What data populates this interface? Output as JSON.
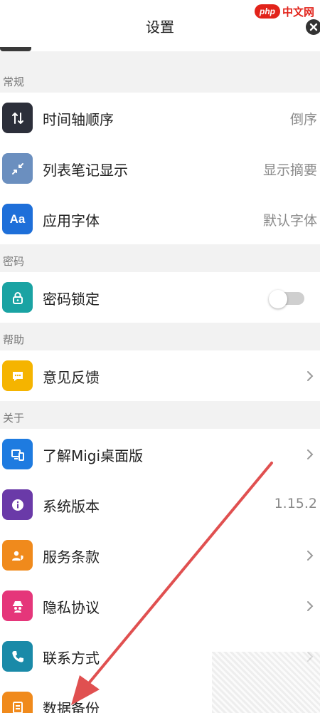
{
  "header": {
    "title": "设置"
  },
  "watermark": {
    "logo": "php",
    "text": "中文网"
  },
  "sections": {
    "general": {
      "label": "常规"
    },
    "password": {
      "label": "密码"
    },
    "help": {
      "label": "帮助"
    },
    "about": {
      "label": "关于"
    }
  },
  "general": [
    {
      "label": "时间轴顺序",
      "value": "倒序",
      "icon": "sort-arrows-icon",
      "color": "#2c2f3a"
    },
    {
      "label": "列表笔记显示",
      "value": "显示摘要",
      "icon": "collapse-icon",
      "color": "#6b8fbf"
    },
    {
      "label": "应用字体",
      "value": "默认字体",
      "icon": "font-icon",
      "color": "#1e6fd9"
    }
  ],
  "password": [
    {
      "label": "密码锁定",
      "icon": "lock-icon",
      "color": "#1aa3a3",
      "toggle_on": false
    }
  ],
  "help": [
    {
      "label": "意见反馈",
      "icon": "chat-bubble-icon",
      "color": "#f5b400"
    }
  ],
  "about": [
    {
      "label": "了解Migi桌面版",
      "icon": "devices-icon",
      "color": "#1e7be0"
    },
    {
      "label": "系统版本",
      "value": "1.15.2",
      "icon": "info-icon",
      "color": "#6a3aa8"
    },
    {
      "label": "服务条款",
      "icon": "user-shield-icon",
      "color": "#f08a1c"
    },
    {
      "label": "隐私协议",
      "icon": "privacy-icon",
      "color": "#e5367a"
    },
    {
      "label": "联系方式",
      "icon": "phone-icon",
      "color": "#1a8aa8"
    },
    {
      "label": "数据备份",
      "icon": "backup-icon",
      "color": "#f08a1c"
    }
  ],
  "annotation": {
    "arrow_color": "#e05050"
  }
}
